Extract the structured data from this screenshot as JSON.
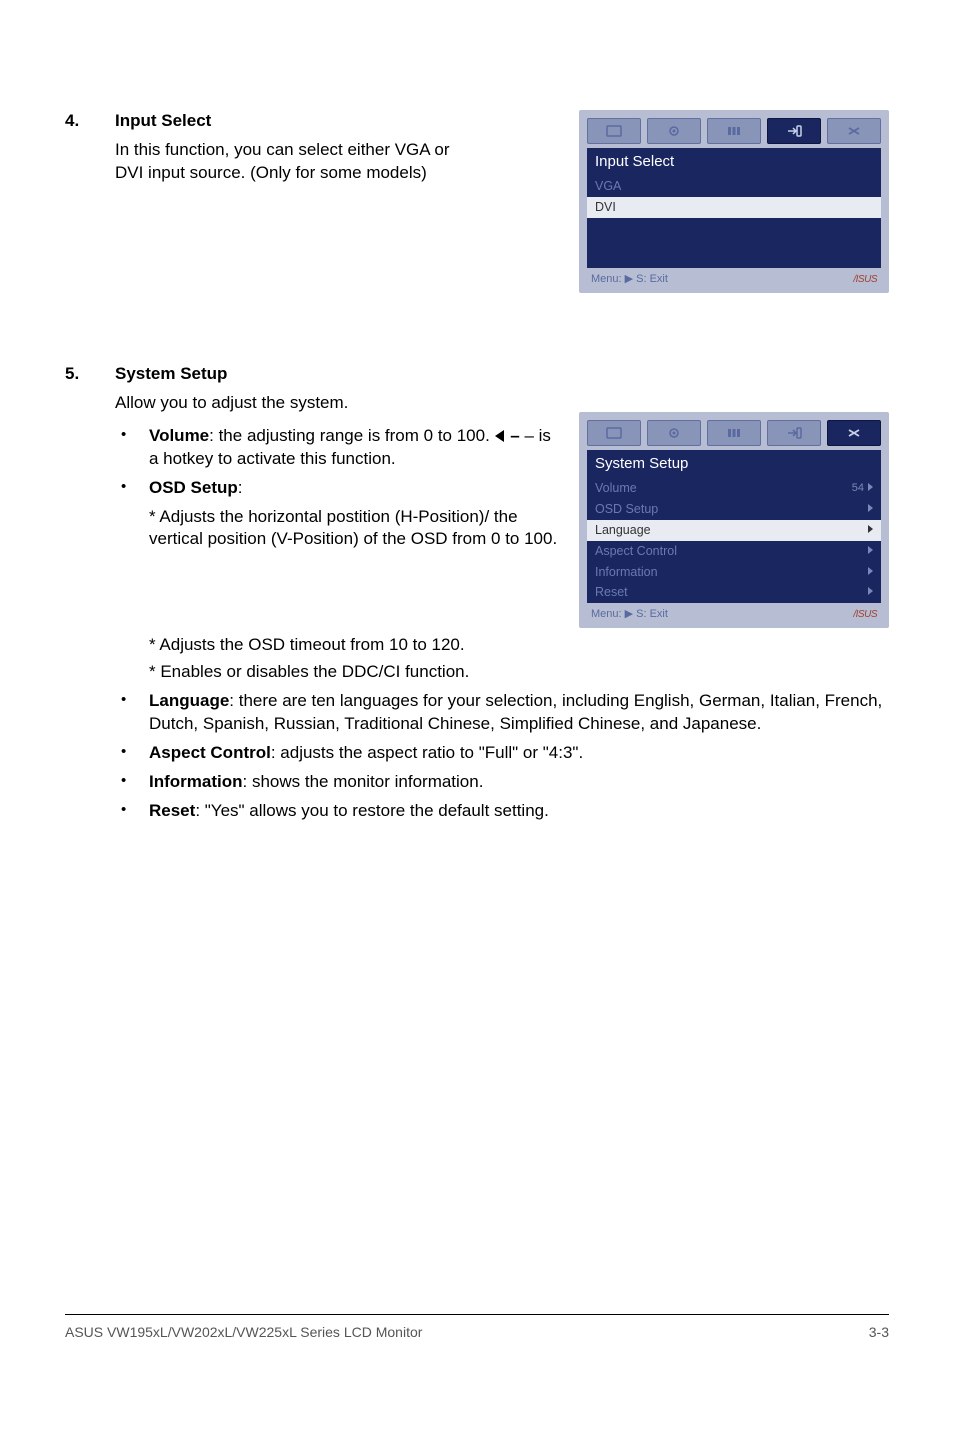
{
  "section4": {
    "num": "4.",
    "title": "Input Select",
    "intro": "In this function, you can select either VGA or DVI input source. (Only for some models)"
  },
  "osd4": {
    "title": "Input Select",
    "items": [
      {
        "label": "VGA",
        "selected": false,
        "dim": true
      },
      {
        "label": "DVI",
        "selected": true
      }
    ],
    "footer_left": "Menu: ▶   S: Exit",
    "footer_right": "/ISUS"
  },
  "section5": {
    "num": "5.",
    "title": "System Setup",
    "intro": "Allow you to adjust the system.",
    "bullets_top": [
      {
        "lead": "Volume",
        "text": ": the adjusting range is from 0 to 100. ",
        "hotkey": " – is a hotkey to activate this function."
      },
      {
        "lead": "OSD Setup",
        "text": ":"
      }
    ],
    "osd_sub": [
      "* Adjusts the horizontal postition (H-Position)/ the vertical position (V-Position) of the OSD from 0 to 100.",
      "* Adjusts the OSD timeout from 10 to 120.",
      "* Enables or disables the DDC/CI function."
    ],
    "bullets_bottom": [
      {
        "lead": "Language",
        "text": ": there are ten languages for your selection, including English, German, Italian, French, Dutch, Spanish, Russian, Traditional Chinese, Simplified Chinese, and Japanese."
      },
      {
        "lead": "Aspect Control",
        "text": ": adjusts the aspect ratio to \"Full\" or \"4:3\"."
      },
      {
        "lead": "Information",
        "text": ": shows the monitor information."
      },
      {
        "lead": "Reset",
        "text": ": \"Yes\" allows you to restore the default setting."
      }
    ]
  },
  "osd5": {
    "title": "System Setup",
    "items": [
      {
        "label": "Volume",
        "value": "54",
        "has_arrow": true
      },
      {
        "label": "OSD Setup",
        "has_arrow": true
      },
      {
        "label": "Language",
        "selected": true,
        "has_arrow": true
      },
      {
        "label": "Aspect Control",
        "has_arrow": true
      },
      {
        "label": "Information",
        "has_arrow": true
      },
      {
        "label": "Reset",
        "has_arrow": true
      }
    ],
    "footer_left": "Menu: ▶   S: Exit",
    "footer_right": "/ISUS"
  },
  "footer": {
    "left": "ASUS VW195xL/VW202xL/VW225xL Series LCD Monitor",
    "right": "3-3"
  }
}
